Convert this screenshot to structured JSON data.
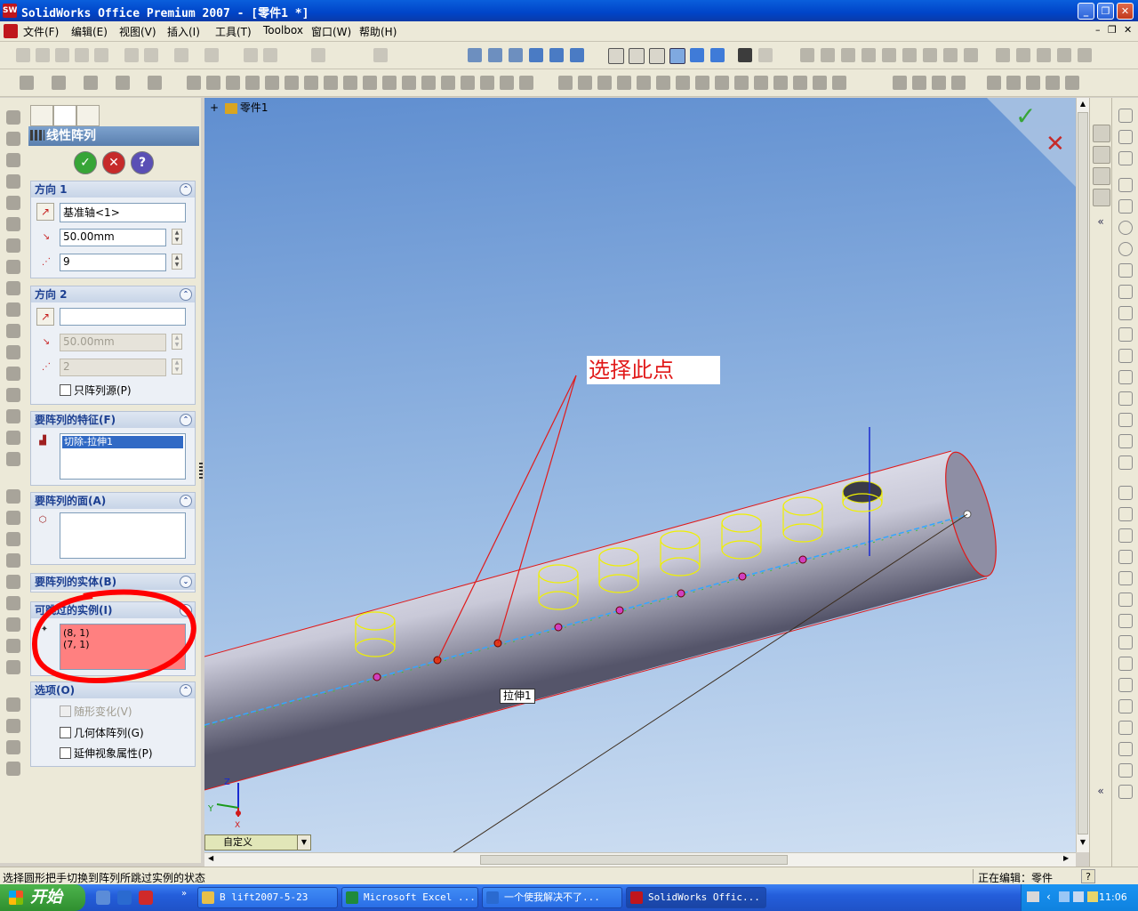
{
  "window": {
    "title": "SolidWorks Office Premium 2007 - [零件1 *]",
    "app_icon": "sw-logo-icon"
  },
  "menu": [
    "文件(F)",
    "编辑(E)",
    "视图(V)",
    "插入(I)",
    "工具(T)",
    "Toolbox",
    "窗口(W)",
    "帮助(H)"
  ],
  "tree": {
    "root": "零件1"
  },
  "property_manager": {
    "title": "线性阵列",
    "direction1": {
      "header": "方向 1",
      "reference": "基准轴<1>",
      "spacing": "50.00mm",
      "count": "9"
    },
    "direction2": {
      "header": "方向 2",
      "reference": "",
      "spacing": "50.00mm",
      "count": "2",
      "pattern_seed_only": "只阵列源(P)"
    },
    "features": {
      "header": "要阵列的特征(F)",
      "items": [
        "切除-拉伸1"
      ]
    },
    "faces": {
      "header": "要阵列的面(A)"
    },
    "bodies": {
      "header": "要阵列的实体(B)"
    },
    "skip": {
      "header": "可跳过的实例(I)",
      "items": [
        "(8, 1)",
        "(7, 1)"
      ]
    },
    "options": {
      "header": "选项(O)",
      "vary_sketch": "随形变化(V)",
      "geometry_pattern": "几何体阵列(G)",
      "propagate_visual": "延伸视象属性(P)"
    }
  },
  "viewport": {
    "annotation": "选择此点",
    "tooltip": "拉伸1",
    "view_orientation": "自定义",
    "triad": {
      "x": "X",
      "y": "Y",
      "z": "Z"
    }
  },
  "status": {
    "left": "选择圆形把手切换到阵列所跳过实例的状态",
    "right": "正在编辑：零件"
  },
  "taskbar": {
    "start": "开始",
    "tasks": [
      "B lift2007-5-23",
      "Microsoft Excel ...",
      "一个使我解决不了...",
      "SolidWorks Offic..."
    ],
    "clock": "11:06"
  },
  "colors": {
    "highlight": "#ff8080",
    "annotation": "#e11a1a",
    "accent": "#0044c8"
  }
}
